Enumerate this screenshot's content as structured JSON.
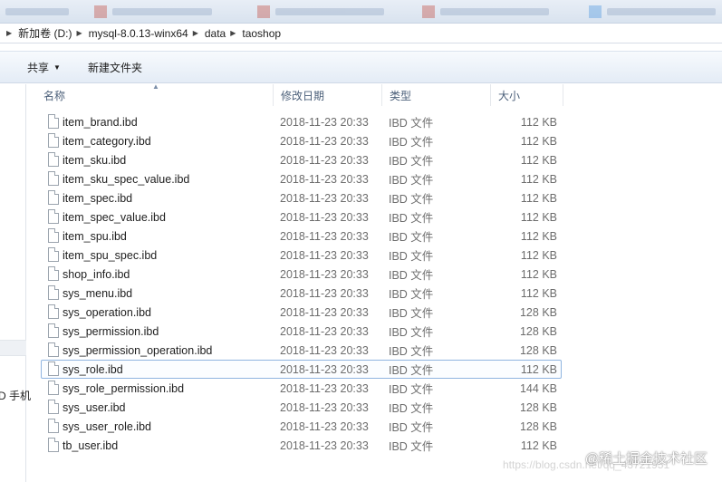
{
  "breadcrumb": [
    "新加卷 (D:)",
    "mysql-8.0.13-winx64",
    "data",
    "taoshop"
  ],
  "toolbar": {
    "share_label": "共享",
    "new_folder_label": "新建文件夹"
  },
  "columns": {
    "name": "名称",
    "date": "修改日期",
    "type": "类型",
    "size": "大小"
  },
  "nav": {
    "partial_text": "D 手机"
  },
  "files": [
    {
      "name": "item_brand.ibd",
      "date": "2018-11-23 20:33",
      "type": "IBD 文件",
      "size": "112 KB"
    },
    {
      "name": "item_category.ibd",
      "date": "2018-11-23 20:33",
      "type": "IBD 文件",
      "size": "112 KB"
    },
    {
      "name": "item_sku.ibd",
      "date": "2018-11-23 20:33",
      "type": "IBD 文件",
      "size": "112 KB"
    },
    {
      "name": "item_sku_spec_value.ibd",
      "date": "2018-11-23 20:33",
      "type": "IBD 文件",
      "size": "112 KB"
    },
    {
      "name": "item_spec.ibd",
      "date": "2018-11-23 20:33",
      "type": "IBD 文件",
      "size": "112 KB"
    },
    {
      "name": "item_spec_value.ibd",
      "date": "2018-11-23 20:33",
      "type": "IBD 文件",
      "size": "112 KB"
    },
    {
      "name": "item_spu.ibd",
      "date": "2018-11-23 20:33",
      "type": "IBD 文件",
      "size": "112 KB"
    },
    {
      "name": "item_spu_spec.ibd",
      "date": "2018-11-23 20:33",
      "type": "IBD 文件",
      "size": "112 KB"
    },
    {
      "name": "shop_info.ibd",
      "date": "2018-11-23 20:33",
      "type": "IBD 文件",
      "size": "112 KB"
    },
    {
      "name": "sys_menu.ibd",
      "date": "2018-11-23 20:33",
      "type": "IBD 文件",
      "size": "112 KB"
    },
    {
      "name": "sys_operation.ibd",
      "date": "2018-11-23 20:33",
      "type": "IBD 文件",
      "size": "128 KB"
    },
    {
      "name": "sys_permission.ibd",
      "date": "2018-11-23 20:33",
      "type": "IBD 文件",
      "size": "128 KB"
    },
    {
      "name": "sys_permission_operation.ibd",
      "date": "2018-11-23 20:33",
      "type": "IBD 文件",
      "size": "128 KB"
    },
    {
      "name": "sys_role.ibd",
      "date": "2018-11-23 20:33",
      "type": "IBD 文件",
      "size": "112 KB",
      "selected": true
    },
    {
      "name": "sys_role_permission.ibd",
      "date": "2018-11-23 20:33",
      "type": "IBD 文件",
      "size": "144 KB"
    },
    {
      "name": "sys_user.ibd",
      "date": "2018-11-23 20:33",
      "type": "IBD 文件",
      "size": "128 KB"
    },
    {
      "name": "sys_user_role.ibd",
      "date": "2018-11-23 20:33",
      "type": "IBD 文件",
      "size": "128 KB"
    },
    {
      "name": "tb_user.ibd",
      "date": "2018-11-23 20:33",
      "type": "IBD 文件",
      "size": "112 KB"
    }
  ],
  "watermark": {
    "text": "@稀土掘金技术社区",
    "url": "https://blog.csdn.net/qq_43721951"
  },
  "icons": {
    "file": "file-icon",
    "breadcrumb_separator": "chevron-right-icon",
    "dropdown": "chevron-down-icon",
    "sort": "sort-up-icon"
  }
}
